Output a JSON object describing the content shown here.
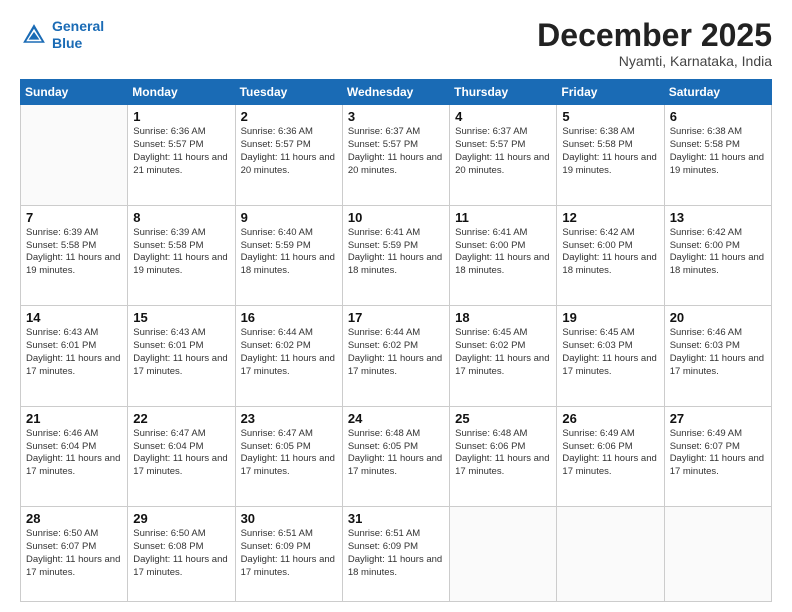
{
  "header": {
    "logo_line1": "General",
    "logo_line2": "Blue",
    "month": "December 2025",
    "location": "Nyamti, Karnataka, India"
  },
  "days_of_week": [
    "Sunday",
    "Monday",
    "Tuesday",
    "Wednesday",
    "Thursday",
    "Friday",
    "Saturday"
  ],
  "weeks": [
    [
      {
        "day": "",
        "sunrise": "",
        "sunset": "",
        "daylight": ""
      },
      {
        "day": "1",
        "sunrise": "6:36 AM",
        "sunset": "5:57 PM",
        "daylight": "11 hours and 21 minutes."
      },
      {
        "day": "2",
        "sunrise": "6:36 AM",
        "sunset": "5:57 PM",
        "daylight": "11 hours and 20 minutes."
      },
      {
        "day": "3",
        "sunrise": "6:37 AM",
        "sunset": "5:57 PM",
        "daylight": "11 hours and 20 minutes."
      },
      {
        "day": "4",
        "sunrise": "6:37 AM",
        "sunset": "5:57 PM",
        "daylight": "11 hours and 20 minutes."
      },
      {
        "day": "5",
        "sunrise": "6:38 AM",
        "sunset": "5:58 PM",
        "daylight": "11 hours and 19 minutes."
      },
      {
        "day": "6",
        "sunrise": "6:38 AM",
        "sunset": "5:58 PM",
        "daylight": "11 hours and 19 minutes."
      }
    ],
    [
      {
        "day": "7",
        "sunrise": "6:39 AM",
        "sunset": "5:58 PM",
        "daylight": "11 hours and 19 minutes."
      },
      {
        "day": "8",
        "sunrise": "6:39 AM",
        "sunset": "5:58 PM",
        "daylight": "11 hours and 19 minutes."
      },
      {
        "day": "9",
        "sunrise": "6:40 AM",
        "sunset": "5:59 PM",
        "daylight": "11 hours and 18 minutes."
      },
      {
        "day": "10",
        "sunrise": "6:41 AM",
        "sunset": "5:59 PM",
        "daylight": "11 hours and 18 minutes."
      },
      {
        "day": "11",
        "sunrise": "6:41 AM",
        "sunset": "6:00 PM",
        "daylight": "11 hours and 18 minutes."
      },
      {
        "day": "12",
        "sunrise": "6:42 AM",
        "sunset": "6:00 PM",
        "daylight": "11 hours and 18 minutes."
      },
      {
        "day": "13",
        "sunrise": "6:42 AM",
        "sunset": "6:00 PM",
        "daylight": "11 hours and 18 minutes."
      }
    ],
    [
      {
        "day": "14",
        "sunrise": "6:43 AM",
        "sunset": "6:01 PM",
        "daylight": "11 hours and 17 minutes."
      },
      {
        "day": "15",
        "sunrise": "6:43 AM",
        "sunset": "6:01 PM",
        "daylight": "11 hours and 17 minutes."
      },
      {
        "day": "16",
        "sunrise": "6:44 AM",
        "sunset": "6:02 PM",
        "daylight": "11 hours and 17 minutes."
      },
      {
        "day": "17",
        "sunrise": "6:44 AM",
        "sunset": "6:02 PM",
        "daylight": "11 hours and 17 minutes."
      },
      {
        "day": "18",
        "sunrise": "6:45 AM",
        "sunset": "6:02 PM",
        "daylight": "11 hours and 17 minutes."
      },
      {
        "day": "19",
        "sunrise": "6:45 AM",
        "sunset": "6:03 PM",
        "daylight": "11 hours and 17 minutes."
      },
      {
        "day": "20",
        "sunrise": "6:46 AM",
        "sunset": "6:03 PM",
        "daylight": "11 hours and 17 minutes."
      }
    ],
    [
      {
        "day": "21",
        "sunrise": "6:46 AM",
        "sunset": "6:04 PM",
        "daylight": "11 hours and 17 minutes."
      },
      {
        "day": "22",
        "sunrise": "6:47 AM",
        "sunset": "6:04 PM",
        "daylight": "11 hours and 17 minutes."
      },
      {
        "day": "23",
        "sunrise": "6:47 AM",
        "sunset": "6:05 PM",
        "daylight": "11 hours and 17 minutes."
      },
      {
        "day": "24",
        "sunrise": "6:48 AM",
        "sunset": "6:05 PM",
        "daylight": "11 hours and 17 minutes."
      },
      {
        "day": "25",
        "sunrise": "6:48 AM",
        "sunset": "6:06 PM",
        "daylight": "11 hours and 17 minutes."
      },
      {
        "day": "26",
        "sunrise": "6:49 AM",
        "sunset": "6:06 PM",
        "daylight": "11 hours and 17 minutes."
      },
      {
        "day": "27",
        "sunrise": "6:49 AM",
        "sunset": "6:07 PM",
        "daylight": "11 hours and 17 minutes."
      }
    ],
    [
      {
        "day": "28",
        "sunrise": "6:50 AM",
        "sunset": "6:07 PM",
        "daylight": "11 hours and 17 minutes."
      },
      {
        "day": "29",
        "sunrise": "6:50 AM",
        "sunset": "6:08 PM",
        "daylight": "11 hours and 17 minutes."
      },
      {
        "day": "30",
        "sunrise": "6:51 AM",
        "sunset": "6:09 PM",
        "daylight": "11 hours and 17 minutes."
      },
      {
        "day": "31",
        "sunrise": "6:51 AM",
        "sunset": "6:09 PM",
        "daylight": "11 hours and 18 minutes."
      },
      {
        "day": "",
        "sunrise": "",
        "sunset": "",
        "daylight": ""
      },
      {
        "day": "",
        "sunrise": "",
        "sunset": "",
        "daylight": ""
      },
      {
        "day": "",
        "sunrise": "",
        "sunset": "",
        "daylight": ""
      }
    ]
  ]
}
